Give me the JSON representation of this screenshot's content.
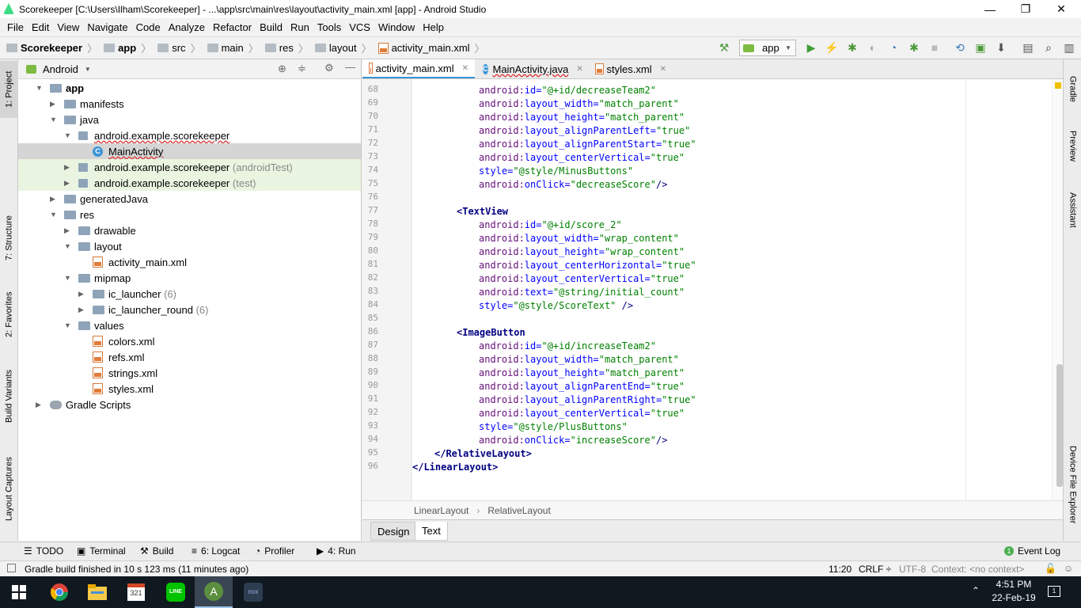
{
  "window": {
    "title": "Scorekeeper [C:\\Users\\Ilham\\Scorekeeper] - ...\\app\\src\\main\\res\\layout\\activity_main.xml [app] - Android Studio",
    "minimize": "—",
    "maximize": "❐",
    "close": "✕"
  },
  "menu": [
    "File",
    "Edit",
    "View",
    "Navigate",
    "Code",
    "Analyze",
    "Refactor",
    "Build",
    "Run",
    "Tools",
    "VCS",
    "Window",
    "Help"
  ],
  "breadcrumbs": [
    "Scorekeeper",
    "app",
    "src",
    "main",
    "res",
    "layout",
    "activity_main.xml"
  ],
  "run_config": "app",
  "left_tool_tabs": [
    "1: Project",
    "7: Structure",
    "2: Favorites",
    "Build Variants",
    "Layout Captures"
  ],
  "right_tool_tabs": [
    "Gradle",
    "Preview",
    "Assistant",
    "Device File Explorer"
  ],
  "project_panel": {
    "view_mode": "Android",
    "tree": [
      {
        "label": "app",
        "extra": "",
        "level": 0,
        "arrow": "▼",
        "icon": "folder",
        "bold": true
      },
      {
        "label": "manifests",
        "extra": "",
        "level": 1,
        "arrow": "▶",
        "icon": "folder"
      },
      {
        "label": "java",
        "extra": "",
        "level": 1,
        "arrow": "▼",
        "icon": "folder"
      },
      {
        "label": "android.example.scorekeeper",
        "extra": "",
        "level": 2,
        "arrow": "▼",
        "icon": "package"
      },
      {
        "label": "MainActivity",
        "extra": "",
        "level": 3,
        "arrow": "",
        "icon": "class",
        "selected": true
      },
      {
        "label": "android.example.scorekeeper",
        "extra": "(androidTest)",
        "level": 2,
        "arrow": "▶",
        "icon": "package",
        "green": true
      },
      {
        "label": "android.example.scorekeeper",
        "extra": "(test)",
        "level": 2,
        "arrow": "▶",
        "icon": "package",
        "green": true
      },
      {
        "label": "generatedJava",
        "extra": "",
        "level": 1,
        "arrow": "▶",
        "icon": "folder"
      },
      {
        "label": "res",
        "extra": "",
        "level": 1,
        "arrow": "▼",
        "icon": "folder"
      },
      {
        "label": "drawable",
        "extra": "",
        "level": 2,
        "arrow": "▶",
        "icon": "folder"
      },
      {
        "label": "layout",
        "extra": "",
        "level": 2,
        "arrow": "▼",
        "icon": "folder"
      },
      {
        "label": "activity_main.xml",
        "extra": "",
        "level": 3,
        "arrow": "",
        "icon": "xml"
      },
      {
        "label": "mipmap",
        "extra": "",
        "level": 2,
        "arrow": "▼",
        "icon": "folder"
      },
      {
        "label": "ic_launcher",
        "extra": "(6)",
        "level": 3,
        "arrow": "▶",
        "icon": "folder"
      },
      {
        "label": "ic_launcher_round",
        "extra": "(6)",
        "level": 3,
        "arrow": "▶",
        "icon": "folder"
      },
      {
        "label": "values",
        "extra": "",
        "level": 2,
        "arrow": "▼",
        "icon": "folder"
      },
      {
        "label": "colors.xml",
        "extra": "",
        "level": 3,
        "arrow": "",
        "icon": "xml"
      },
      {
        "label": "refs.xml",
        "extra": "",
        "level": 3,
        "arrow": "",
        "icon": "xml"
      },
      {
        "label": "strings.xml",
        "extra": "",
        "level": 3,
        "arrow": "",
        "icon": "xml"
      },
      {
        "label": "styles.xml",
        "extra": "",
        "level": 3,
        "arrow": "",
        "icon": "xml"
      },
      {
        "label": "Gradle Scripts",
        "extra": "",
        "level": 0,
        "arrow": "▶",
        "icon": "gradle"
      }
    ]
  },
  "editor_tabs": [
    {
      "label": "activity_main.xml",
      "active": true
    },
    {
      "label": "MainActivity.java",
      "active": false
    },
    {
      "label": "styles.xml",
      "active": false
    }
  ],
  "code_lines": [
    {
      "n": "68",
      "indent": 6,
      "attr": "id",
      "val": "@+id/decreaseTeam2"
    },
    {
      "n": "69",
      "indent": 6,
      "attr": "layout_width",
      "val": "match_parent"
    },
    {
      "n": "70",
      "indent": 6,
      "attr": "layout_height",
      "val": "match_parent"
    },
    {
      "n": "71",
      "indent": 6,
      "attr": "layout_alignParentLeft",
      "val": "true"
    },
    {
      "n": "72",
      "indent": 6,
      "attr": "layout_alignParentStart",
      "val": "true"
    },
    {
      "n": "73",
      "indent": 6,
      "attr": "layout_centerVertical",
      "val": "true"
    },
    {
      "n": "74",
      "indent": 6,
      "plain": "style",
      "val": "@style/MinusButtons"
    },
    {
      "n": "75",
      "indent": 6,
      "attr": "onClick",
      "val": "decreaseScore",
      "close": "/>"
    },
    {
      "n": "76",
      "indent": 0,
      "blank": true
    },
    {
      "n": "77",
      "indent": 4,
      "tag": "<TextView"
    },
    {
      "n": "78",
      "indent": 6,
      "attr": "id",
      "val": "@+id/score_2"
    },
    {
      "n": "79",
      "indent": 6,
      "attr": "layout_width",
      "val": "wrap_content"
    },
    {
      "n": "80",
      "indent": 6,
      "attr": "layout_height",
      "val": "wrap_content"
    },
    {
      "n": "81",
      "indent": 6,
      "attr": "layout_centerHorizontal",
      "val": "true"
    },
    {
      "n": "82",
      "indent": 6,
      "attr": "layout_centerVertical",
      "val": "true"
    },
    {
      "n": "83",
      "indent": 6,
      "attr": "text",
      "val": "@string/initial_count"
    },
    {
      "n": "84",
      "indent": 6,
      "plain": "style",
      "val": "@style/ScoreText",
      "close": " />"
    },
    {
      "n": "85",
      "indent": 0,
      "blank": true
    },
    {
      "n": "86",
      "indent": 4,
      "tag": "<ImageButton"
    },
    {
      "n": "87",
      "indent": 6,
      "attr": "id",
      "val": "@+id/increaseTeam2"
    },
    {
      "n": "88",
      "indent": 6,
      "attr": "layout_width",
      "val": "match_parent"
    },
    {
      "n": "89",
      "indent": 6,
      "attr": "layout_height",
      "val": "match_parent"
    },
    {
      "n": "90",
      "indent": 6,
      "attr": "layout_alignParentEnd",
      "val": "true"
    },
    {
      "n": "91",
      "indent": 6,
      "attr": "layout_alignParentRight",
      "val": "true"
    },
    {
      "n": "92",
      "indent": 6,
      "attr": "layout_centerVertical",
      "val": "true"
    },
    {
      "n": "93",
      "indent": 6,
      "plain": "style",
      "val": "@style/PlusButtons"
    },
    {
      "n": "94",
      "indent": 6,
      "attr": "onClick",
      "val": "increaseScore",
      "close": "/>"
    },
    {
      "n": "95",
      "indent": 2,
      "tag": "</RelativeLayout>"
    },
    {
      "n": "96",
      "indent": 0,
      "tag": "</LinearLayout>"
    }
  ],
  "editor_breadcrumb": [
    "LinearLayout",
    "RelativeLayout"
  ],
  "design_tabs": [
    "Design",
    "Text"
  ],
  "bottom_tools": [
    "TODO",
    "Terminal",
    "Build",
    "6: Logcat",
    "Profiler",
    "4: Run"
  ],
  "event_log": "Event Log",
  "event_log_count": "1",
  "status": {
    "message": "Gradle build finished in 10 s 123 ms (11 minutes ago)",
    "position": "11:20",
    "line_sep": "CRLF ÷",
    "encoding": "UTF-8",
    "context": "Context: <no context>"
  },
  "taskbar": {
    "time": "4:51 PM",
    "date": "22-Feb-19",
    "apps": [
      "chrome",
      "file-explorer",
      "calendar",
      "line",
      "android-studio",
      "nox"
    ],
    "calendar_day": "321",
    "line_label": "LINE",
    "nox_label": "nox",
    "notif_count": "1"
  },
  "colors": {
    "accent": "#3d95d6",
    "selected_row": "#d5d5d5",
    "green_row": "#eaf5e1",
    "xml_attr": "#0000ff",
    "xml_value": "#008000",
    "xml_ns": "#660e7a",
    "xml_tag": "#000080"
  }
}
